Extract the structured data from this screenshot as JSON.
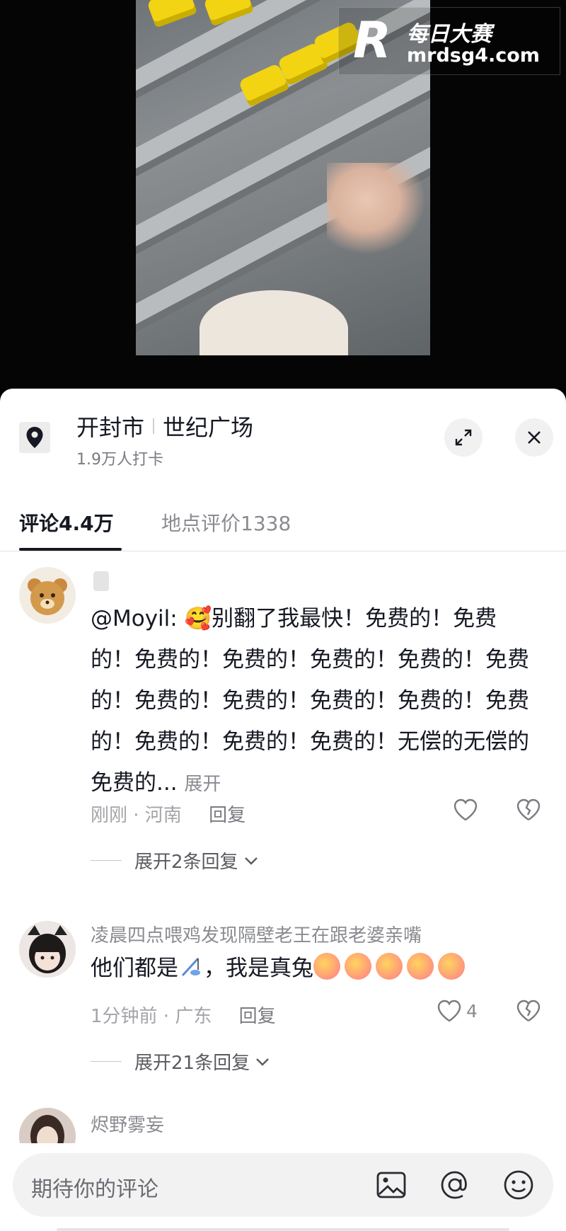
{
  "watermark": {
    "letter": "R",
    "brand": "每日大赛",
    "url": "mrdsg4.com"
  },
  "location": {
    "city": "开封市",
    "place": "世纪广场",
    "checkins": "1.9万人打卡",
    "pin_icon": "map-pin-icon",
    "expand_icon": "expand-icon",
    "close_icon": "close-icon"
  },
  "tabs": [
    {
      "label": "评论4.4万",
      "active": true
    },
    {
      "label": "地点评价1338",
      "active": false
    }
  ],
  "comments": [
    {
      "username": "",
      "text": "@Moyil: 🥰别翻了我最快！免费的！免费的！免费的！免费的！免费的！免费的！免费的！免费的！免费的！免费的！免费的！免费的！免费的！免费的！免费的！无偿的无偿的免费的...",
      "expand_label": "展开",
      "time_location": "刚刚 · 河南",
      "reply_label": "回复",
      "like_count": "",
      "more_replies": "展开2条回复"
    },
    {
      "username": "凌晨四点喂鸡发现隔壁老王在跟老婆亲嘴",
      "text_prefix": "他们都是",
      "text_middle": "，我是真兔",
      "time_location": "1分钟前 · 广东",
      "reply_label": "回复",
      "like_count": "4",
      "more_replies": "展开21条回复"
    },
    {
      "username": "烬野雾妄"
    }
  ],
  "input": {
    "placeholder": "期待你的评论",
    "image_icon": "image-icon",
    "at_icon": "at-icon",
    "emoji_icon": "emoji-icon"
  }
}
